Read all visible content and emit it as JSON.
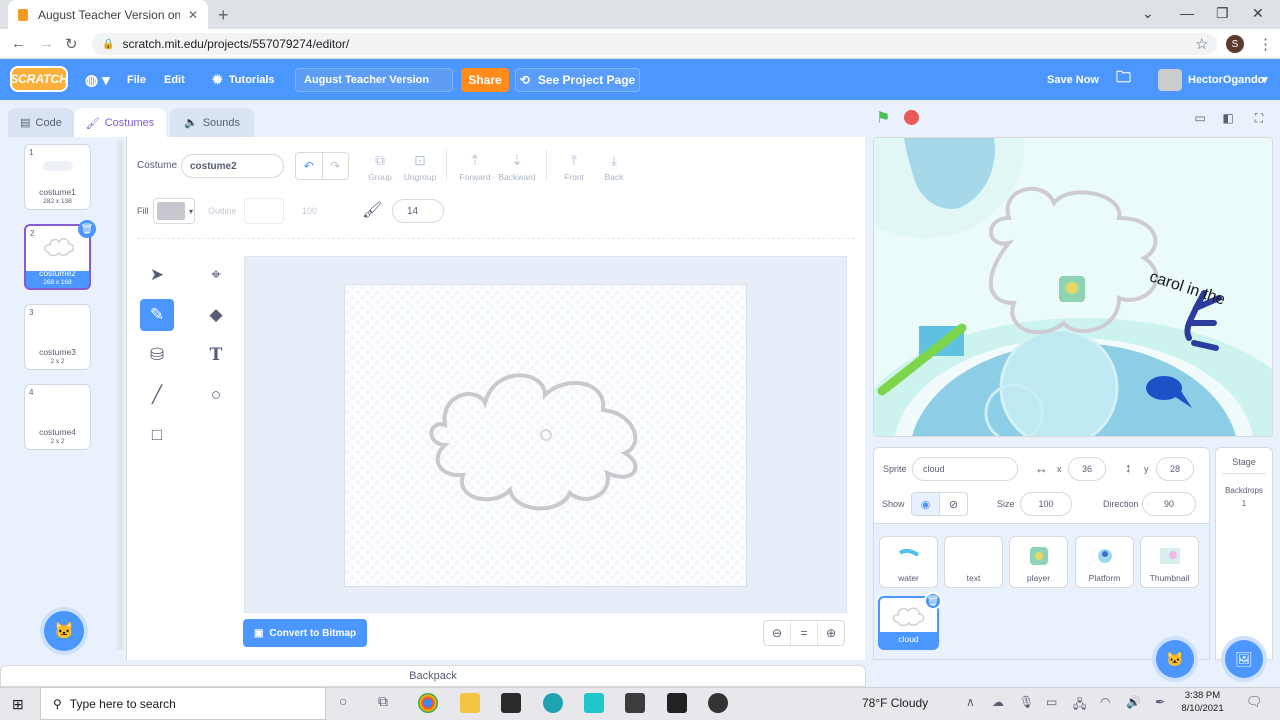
{
  "browser": {
    "tab_title": "August Teacher Version on S",
    "url": "scratch.mit.edu/projects/557079274/editor/",
    "profile_initial": "S"
  },
  "menubar": {
    "logo": "SCRATCH",
    "file": "File",
    "edit": "Edit",
    "tutorials": "Tutorials",
    "project_title": "August Teacher Version",
    "share": "Share",
    "see_project_page": "See Project Page",
    "save_now": "Save Now",
    "username": "HectorOgando"
  },
  "tabs": {
    "code": "Code",
    "costumes": "Costumes",
    "sounds": "Sounds"
  },
  "costumes": [
    {
      "num": "1",
      "name": "costume1",
      "size": "282 x 138"
    },
    {
      "num": "2",
      "name": "costume2",
      "size": "268 x 168"
    },
    {
      "num": "3",
      "name": "costume3",
      "size": "2 x 2"
    },
    {
      "num": "4",
      "name": "costume4",
      "size": "2 x 2"
    }
  ],
  "paint": {
    "costume_label": "Costume",
    "costume_name": "costume2",
    "group": "Group",
    "ungroup": "Ungroup",
    "forward": "Forward",
    "backward": "Backward",
    "front": "Front",
    "back": "Back",
    "fill_label": "Fill",
    "fill_color": "#c9c6cf",
    "outline_label": "Outline",
    "outline_width": "100",
    "brush_size": "14",
    "convert": "Convert to Bitmap"
  },
  "stage_text": "carol in the",
  "sprite_info": {
    "sprite_label": "Sprite",
    "sprite_name": "cloud",
    "x_label": "x",
    "x_value": "36",
    "y_label": "y",
    "y_value": "28",
    "show_label": "Show",
    "size_label": "Size",
    "size_value": "100",
    "direction_label": "Direction",
    "direction_value": "90"
  },
  "sprites": [
    {
      "name": "water"
    },
    {
      "name": "text"
    },
    {
      "name": "player"
    },
    {
      "name": "Platform"
    },
    {
      "name": "Thumbnail"
    },
    {
      "name": "cloud"
    }
  ],
  "stage_pane": {
    "title": "Stage",
    "backdrops_label": "Backdrops",
    "backdrops_count": "1"
  },
  "backpack": "Backpack",
  "taskbar": {
    "search_placeholder": "Type here to search",
    "weather": "78°F  Cloudy",
    "time": "3:38 PM",
    "date": "8/10/2021"
  }
}
